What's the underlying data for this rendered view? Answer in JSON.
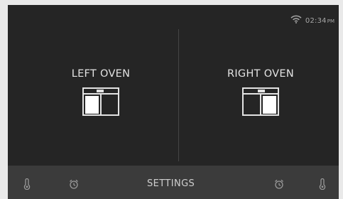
{
  "status": {
    "time": "02:34",
    "ampm": "PM"
  },
  "ovens": [
    {
      "label": "LEFT OVEN"
    },
    {
      "label": "RIGHT OVEN"
    }
  ],
  "bottom_bar": {
    "settings_label": "SETTINGS",
    "icons": [
      "thermometer-icon",
      "alarm-clock-icon",
      "alarm-clock-icon",
      "thermometer-icon"
    ]
  },
  "colors": {
    "screen_bg": "#252525",
    "bar_bg": "#3b3b3b",
    "text": "#e3e3e3",
    "muted": "#a7a7a7"
  }
}
